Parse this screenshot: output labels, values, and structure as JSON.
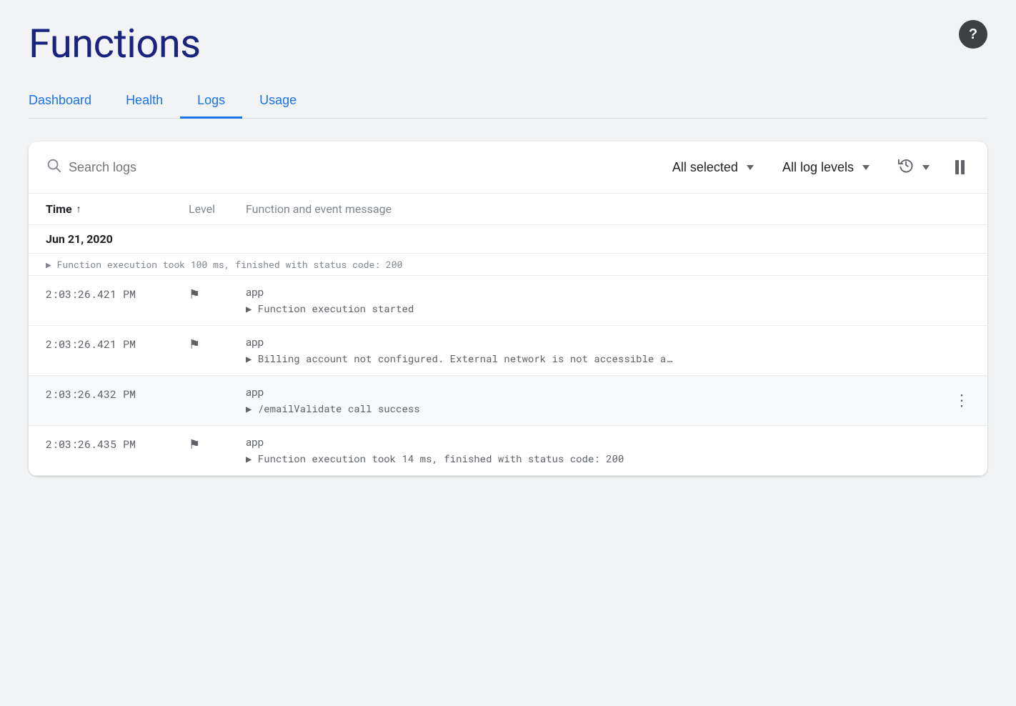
{
  "page": {
    "title": "Functions",
    "help_label": "?"
  },
  "tabs": [
    {
      "id": "dashboard",
      "label": "Dashboard",
      "active": false
    },
    {
      "id": "health",
      "label": "Health",
      "active": false
    },
    {
      "id": "logs",
      "label": "Logs",
      "active": true
    },
    {
      "id": "usage",
      "label": "Usage",
      "active": false
    }
  ],
  "search_bar": {
    "search_placeholder": "Search logs",
    "filter_all_selected": "All selected",
    "filter_log_levels": "All log levels",
    "pause_title": "Pause"
  },
  "table": {
    "col_time": "Time",
    "col_level": "Level",
    "col_message": "Function and event message"
  },
  "date_group": "Jun 21, 2020",
  "truncated_row": "▶ Function execution took 100 ms, finished with status code: 200",
  "log_rows": [
    {
      "id": "row1",
      "time": "2:03:26.421 PM",
      "has_flag": true,
      "source": "app",
      "message": "▶ Function execution started",
      "highlighted": false,
      "has_menu": false
    },
    {
      "id": "row2",
      "time": "2:03:26.421 PM",
      "has_flag": true,
      "source": "app",
      "message": "▶ Billing account not configured. External network is not accessible a…",
      "highlighted": false,
      "has_menu": false
    },
    {
      "id": "row3",
      "time": "2:03:26.432 PM",
      "has_flag": false,
      "source": "app",
      "message": "▶ /emailValidate call success",
      "highlighted": true,
      "has_menu": true,
      "menu_label": "⋮"
    },
    {
      "id": "row4",
      "time": "2:03:26.435 PM",
      "has_flag": true,
      "source": "app",
      "message": "▶ Function execution took 14 ms, finished with status code: 200",
      "highlighted": false,
      "has_menu": false
    }
  ]
}
